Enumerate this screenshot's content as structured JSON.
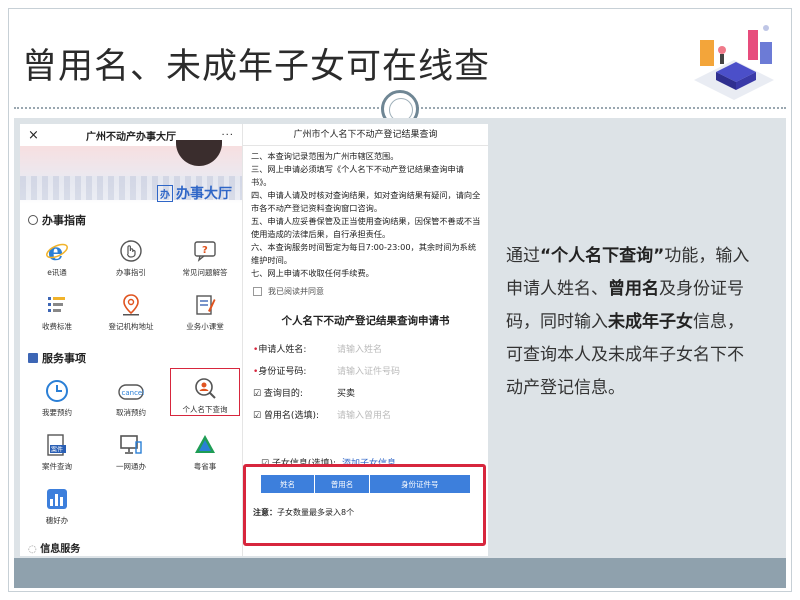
{
  "slide": {
    "title": "曾用名、未成年子女可在线查"
  },
  "left_phone": {
    "close_icon_glyph": "×",
    "title": "广州不动产办事大厅",
    "more_glyph": "···",
    "logo_box": "办",
    "logo_text": "办事大厅",
    "section_guide": "办事指南",
    "guide_items": [
      {
        "label": "e讯通",
        "icon": "ie-icon"
      },
      {
        "label": "办事指引",
        "icon": "hand-icon"
      },
      {
        "label": "常见问题解答",
        "icon": "chat-question-icon"
      },
      {
        "label": "收费标准",
        "icon": "list-icon"
      },
      {
        "label": "登记机构地址",
        "icon": "location-icon"
      },
      {
        "label": "业务小课堂",
        "icon": "notebook-icon"
      }
    ],
    "section_services": "服务事项",
    "service_items": [
      {
        "label": "我要预约",
        "icon": "clock-icon"
      },
      {
        "label": "取消预约",
        "icon": "cancel-icon",
        "icon_text": "cancel"
      },
      {
        "label": "个人名下查询",
        "icon": "person-search-icon"
      },
      {
        "label": "案件查询",
        "icon": "case-icon",
        "icon_text": "案件"
      },
      {
        "label": "一网通办",
        "icon": "monitor-icon"
      },
      {
        "label": "粤省事",
        "icon": "yue-icon"
      },
      {
        "label": "穗好办",
        "icon": "sui-icon"
      }
    ],
    "section_info": "信息服务"
  },
  "right_phone": {
    "title": "广州市个人名下不动产登记结果查询",
    "notice_lines": [
      "二、本查询记录范围为广州市辖区范围。",
      "三、网上申请必须填写《个人名下不动产登记结果查询申请书》。",
      "四、申请人请及时核对查询结果，如对查询结果有疑问，请向全市各不动产登记资料查询窗口咨询。",
      "五、申请人应妥善保管及正当使用查询结果，因保管不善或不当使用造成的法律后果，自行承担责任。",
      "六、本查询服务时间暂定为每日7:00-23:00，其余时间为系统维护时间。",
      "七、网上申请不收取任何手续费。"
    ],
    "agree_label": "我已阅读并同意",
    "form_title": "个人名下不动产登记结果查询申请书",
    "fields": {
      "name_req": "•",
      "name_label": "申请人姓名:",
      "name_placeholder": "请输入姓名",
      "id_req": "•",
      "id_label": "身份证号码:",
      "id_placeholder": "请输入证件号码",
      "purpose_label": "☑ 查询目的:",
      "purpose_value": "买卖",
      "former_label": "☑ 曾用名(选填):",
      "former_placeholder": "请输入曾用名"
    },
    "child_label": "☑ 子女信息(选填):",
    "child_add": "添加子女信息",
    "table_headers": [
      "姓名",
      "曾用名",
      "身份证件号"
    ],
    "note_label": "注意：",
    "note_text": "子女数量最多录入8个"
  },
  "description": {
    "p1": "通过",
    "b1": "“个人名下查询”",
    "p2": "功能，输入申请人姓名、",
    "b2": "曾用名",
    "p3": "及身份证号码，同时输入",
    "b3": "未成年子女",
    "p4": "信息，可查询本人及未成年子女名下不动产登记信息。"
  },
  "colors": {
    "accent_blue": "#2f66c7",
    "highlight_red": "#d7263d",
    "table_blue": "#3d7fdc",
    "footer": "#8fa1ad",
    "content_bg": "#dde3e7"
  }
}
